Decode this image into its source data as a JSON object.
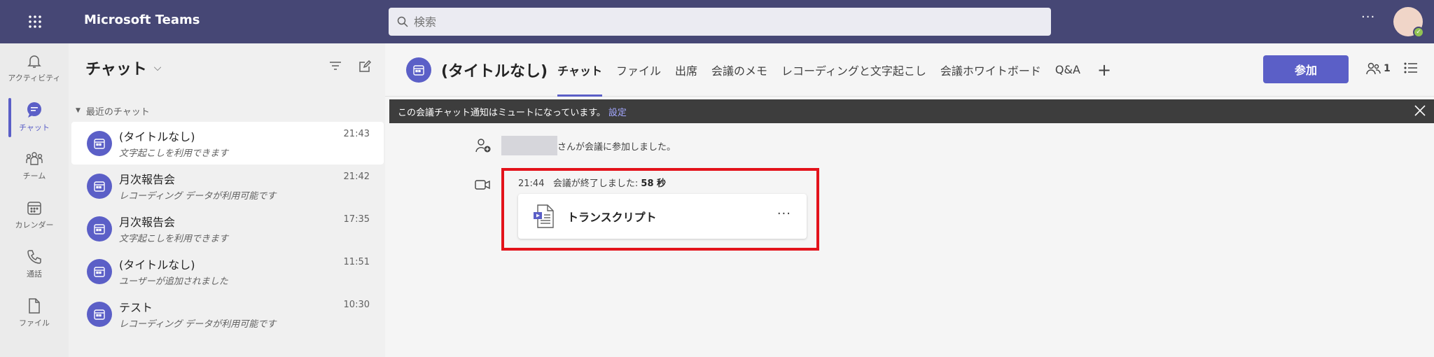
{
  "app": {
    "title": "Microsoft Teams"
  },
  "search": {
    "placeholder": "検索"
  },
  "topbar": {
    "more": "···"
  },
  "rail": [
    {
      "label": "アクティビティ",
      "icon": "bell-icon"
    },
    {
      "label": "チャット",
      "icon": "chat-icon"
    },
    {
      "label": "チーム",
      "icon": "teams-icon"
    },
    {
      "label": "カレンダー",
      "icon": "calendar-icon"
    },
    {
      "label": "通話",
      "icon": "phone-icon"
    },
    {
      "label": "ファイル",
      "icon": "file-icon"
    }
  ],
  "chatlist": {
    "title": "チャット",
    "chevron": "⌵",
    "section": "最近のチャット",
    "items": [
      {
        "name": "(タイトルなし)",
        "sub": "文字起こしを利用できます",
        "time": "21:43"
      },
      {
        "name": "月次報告会",
        "sub": "レコーディング データが利用可能です",
        "time": "21:42"
      },
      {
        "name": "月次報告会",
        "sub": "文字起こしを利用できます",
        "time": "17:35"
      },
      {
        "name": "(タイトルなし)",
        "sub": "ユーザーが追加されました",
        "time": "11:51"
      },
      {
        "name": "テスト",
        "sub": "レコーディング データが利用可能です",
        "time": "10:30"
      }
    ]
  },
  "main": {
    "title": "(タイトルなし)",
    "tabs": [
      "チャット",
      "ファイル",
      "出席",
      "会議のメモ",
      "レコーディングと文字起こし",
      "会議ホワイトボード",
      "Q&A"
    ],
    "tab_add": "+",
    "join_label": "参加",
    "people_count": "1",
    "banner_text": "この会議チャット通知はミュートになっています。",
    "banner_link": "設定",
    "joined_text": "さんが会議に参加しました。",
    "meeting_time": "21:44",
    "meeting_ended": "会議が終了しました:",
    "meeting_duration": "58 秒",
    "card_label": "トランスクリプト",
    "card_more": "···"
  },
  "colors": {
    "topbar": "#464775",
    "accent": "#5b5fc7",
    "highlight": "#e3131b"
  }
}
